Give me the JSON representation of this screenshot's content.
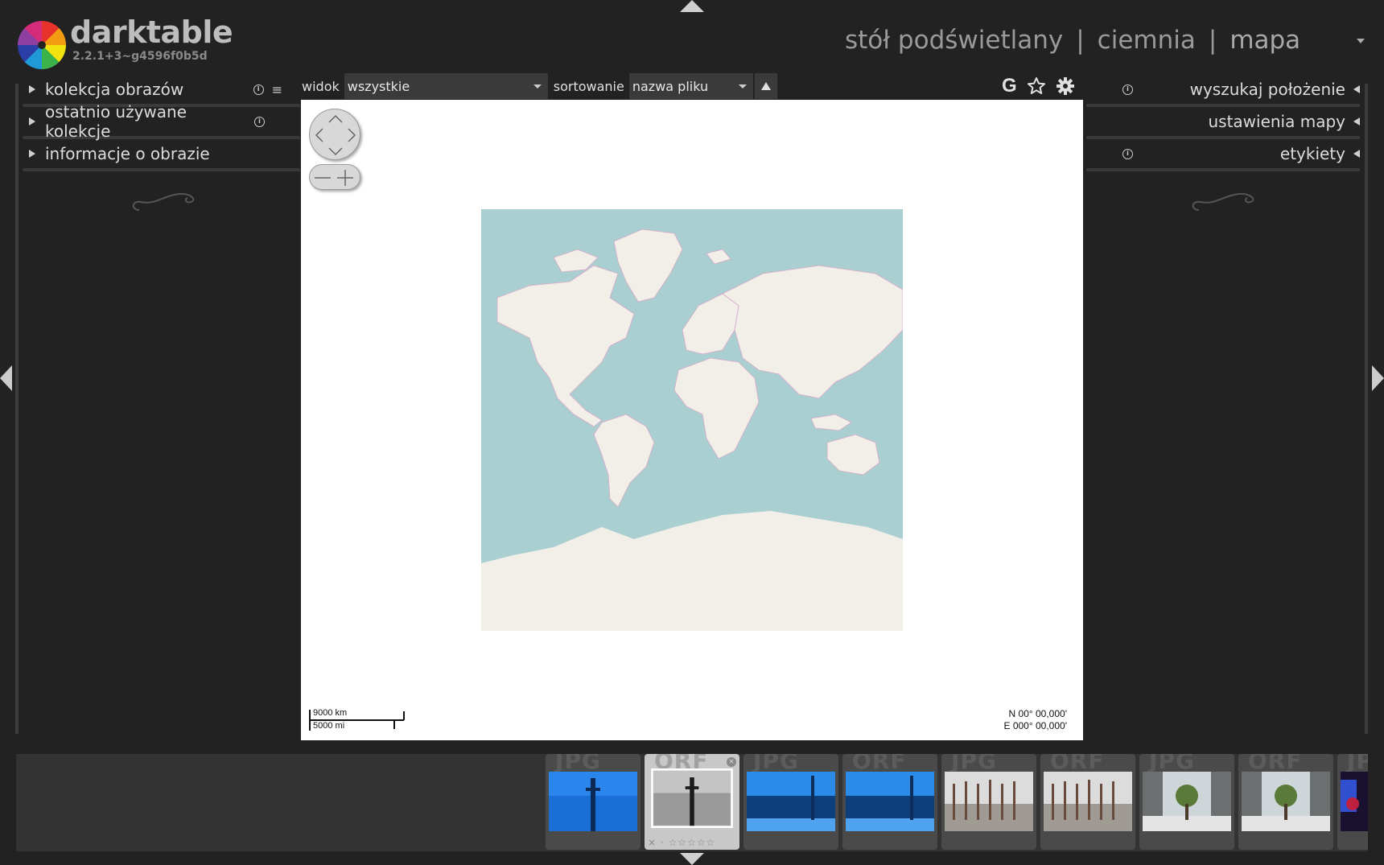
{
  "header": {
    "app_name": "darktable",
    "version": "2.2.1+3~g4596f0b5d",
    "views": [
      "stół podświetlany",
      "ciemnia",
      "mapa"
    ],
    "separator": "|",
    "active_view": "mapa"
  },
  "left_panel": {
    "modules": [
      {
        "label": "kolekcja obrazów",
        "has_info": true,
        "has_menu": true
      },
      {
        "label": "ostatnio używane kolekcje",
        "has_info": true,
        "has_menu": false
      },
      {
        "label": "informacje o obrazie",
        "has_info": false,
        "has_menu": false
      }
    ]
  },
  "right_panel": {
    "modules": [
      {
        "label": "wyszukaj położenie",
        "has_info": true
      },
      {
        "label": "ustawienia mapy",
        "has_info": false
      },
      {
        "label": "etykiety",
        "has_info": true
      }
    ]
  },
  "toolbar": {
    "view_label": "widok",
    "view_value": "wszystkie",
    "sort_label": "sortowanie",
    "sort_value": "nazwa pliku",
    "icons": [
      "grouping-icon",
      "star-icon",
      "gear-icon"
    ],
    "grouping_glyph": "G"
  },
  "map": {
    "scale_km": "9000 km",
    "scale_mi": "5000 mi",
    "coord_lat": "N 00° 00,000'",
    "coord_lon": "E 000° 00,000'"
  },
  "filmstrip": {
    "thumbs": [
      {
        "ext": "JPG",
        "selected": false,
        "tone": "blue-tower"
      },
      {
        "ext": "ORF",
        "selected": true,
        "tone": "gray-tower"
      },
      {
        "ext": "JPG",
        "selected": false,
        "tone": "blue-building"
      },
      {
        "ext": "ORF",
        "selected": false,
        "tone": "blue-building"
      },
      {
        "ext": "JPG",
        "selected": false,
        "tone": "flags"
      },
      {
        "ext": "ORF",
        "selected": false,
        "tone": "flags"
      },
      {
        "ext": "JPG",
        "selected": false,
        "tone": "courtyard"
      },
      {
        "ext": "ORF",
        "selected": false,
        "tone": "courtyard"
      },
      {
        "ext": "JP",
        "selected": false,
        "tone": "night"
      }
    ]
  },
  "colors": {
    "background": "#222222",
    "panel_rule": "#3a3a3a",
    "map_water": "#aacfd0",
    "map_land": "#f2efe9",
    "map_border": "#d8a8c8"
  }
}
